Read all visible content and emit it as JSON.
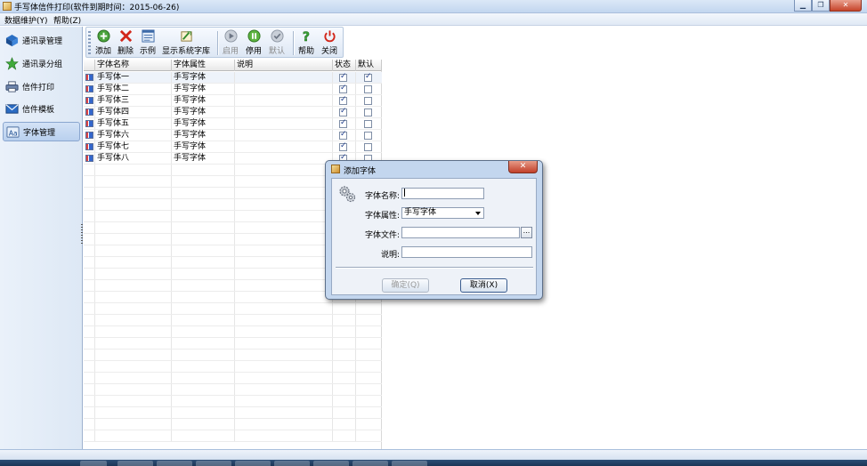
{
  "window": {
    "title": "手写体信件打印(软件到期时间：2015-06-26)",
    "controls": [
      "minimize",
      "maximize",
      "close"
    ]
  },
  "menu": [
    {
      "label": "数据维护(Y)"
    },
    {
      "label": "帮助(Z)"
    }
  ],
  "sidebar": {
    "items": [
      {
        "label": "通讯录管理",
        "icon": "book-icon"
      },
      {
        "label": "通讯录分组",
        "icon": "star-icon"
      },
      {
        "label": "信件打印",
        "icon": "printer-icon"
      },
      {
        "label": "信件模板",
        "icon": "envelope-icon"
      },
      {
        "label": "字体管理",
        "icon": "font-icon",
        "active": true
      }
    ]
  },
  "toolbar": {
    "buttons": [
      {
        "label": "添加",
        "icon": "add-icon",
        "enabled": true
      },
      {
        "label": "删除",
        "icon": "delete-icon",
        "enabled": true
      },
      {
        "label": "示例",
        "icon": "example-icon",
        "enabled": true
      },
      {
        "label": "显示系统字库",
        "icon": "font-library-icon",
        "enabled": true
      },
      {
        "label": "启用",
        "icon": "play-icon",
        "enabled": false
      },
      {
        "label": "停用",
        "icon": "pause-icon",
        "enabled": true
      },
      {
        "label": "默认",
        "icon": "check-icon",
        "enabled": false
      },
      {
        "label": "帮助",
        "icon": "help-icon",
        "enabled": true
      },
      {
        "label": "关闭",
        "icon": "power-icon",
        "enabled": true
      }
    ]
  },
  "grid": {
    "columns": [
      "字体名称",
      "字体属性",
      "说明",
      "状态",
      "默认"
    ],
    "rows": [
      {
        "name": "手写体一",
        "type": "手写字体",
        "note": "",
        "status": true,
        "default": true
      },
      {
        "name": "手写体二",
        "type": "手写字体",
        "note": "",
        "status": true,
        "default": false
      },
      {
        "name": "手写体三",
        "type": "手写字体",
        "note": "",
        "status": true,
        "default": false
      },
      {
        "name": "手写体四",
        "type": "手写字体",
        "note": "",
        "status": true,
        "default": false
      },
      {
        "name": "手写体五",
        "type": "手写字体",
        "note": "",
        "status": true,
        "default": false
      },
      {
        "name": "手写体六",
        "type": "手写字体",
        "note": "",
        "status": true,
        "default": false
      },
      {
        "name": "手写体七",
        "type": "手写字体",
        "note": "",
        "status": true,
        "default": false
      },
      {
        "name": "手写体八",
        "type": "手写字体",
        "note": "",
        "status": true,
        "default": false
      }
    ]
  },
  "dialog": {
    "title": "添加字体",
    "close_label": "✕",
    "fields": {
      "name_label": "字体名称:",
      "name_value": "",
      "type_label": "字体属性:",
      "type_value": "手写字体",
      "file_label": "字体文件:",
      "file_value": "",
      "browse_label": "...",
      "note_label": "说明:",
      "note_value": ""
    },
    "ok_label": "确定(Q)",
    "cancel_label": "取消(X)"
  },
  "colors": {
    "accent": "#2f5e9e",
    "close_red": "#c6442a"
  }
}
